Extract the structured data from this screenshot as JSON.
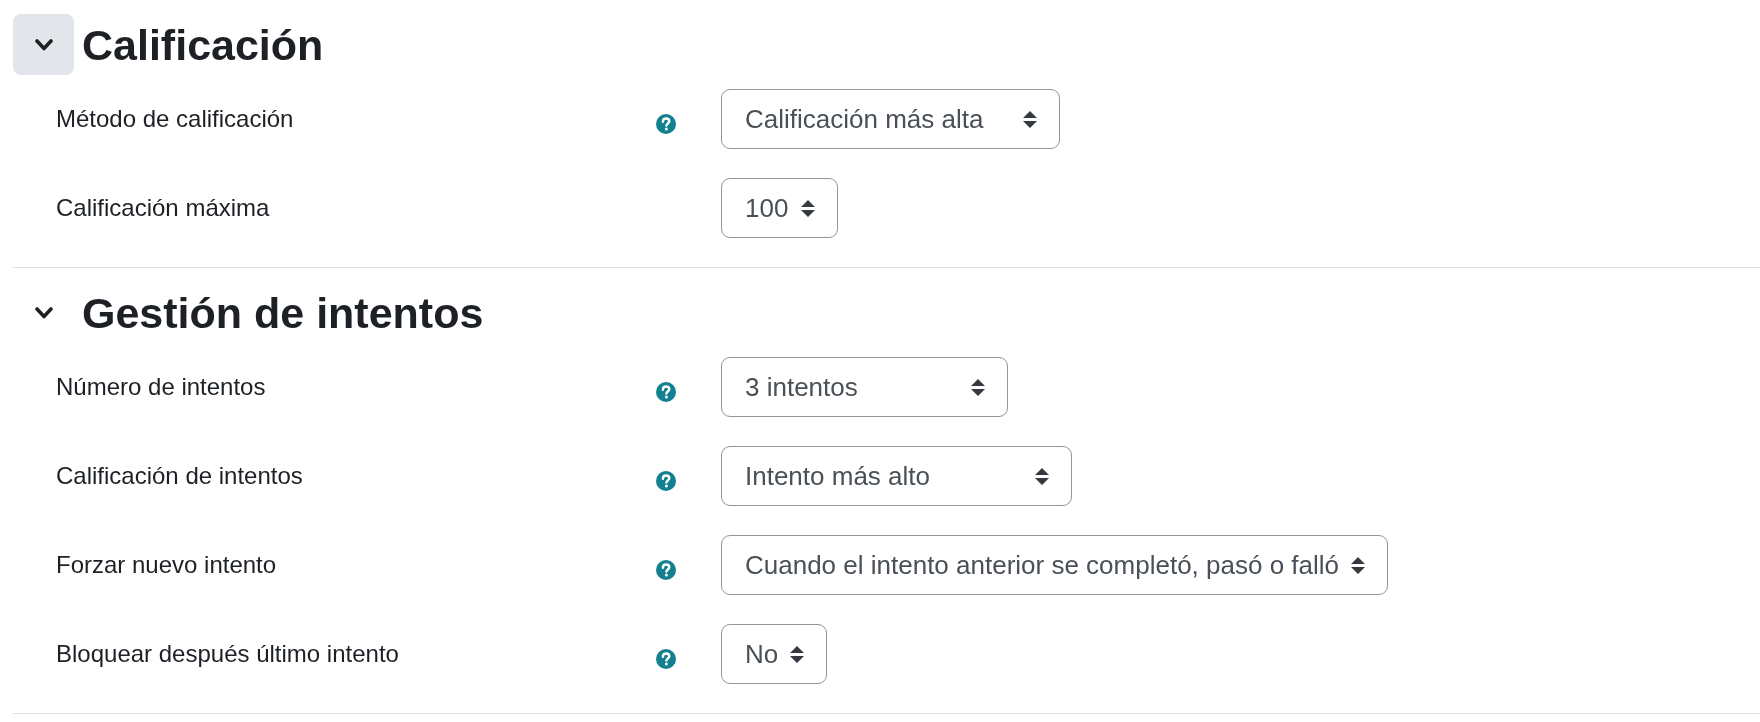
{
  "sections": [
    {
      "title": "Calificación",
      "expanded": true,
      "focused": true,
      "fields": [
        {
          "label": "Método de calificación",
          "help": true,
          "value": "Calificación más alta"
        },
        {
          "label": "Calificación máxima",
          "help": false,
          "value": "100"
        }
      ]
    },
    {
      "title": "Gestión de intentos",
      "expanded": true,
      "focused": false,
      "fields": [
        {
          "label": "Número de intentos",
          "help": true,
          "value": "3 intentos"
        },
        {
          "label": "Calificación de intentos",
          "help": true,
          "value": "Intento más alto"
        },
        {
          "label": "Forzar nuevo intento",
          "help": true,
          "value": "Cuando el intento anterior se completó, pasó o falló"
        },
        {
          "label": "Bloquear después último intento",
          "help": true,
          "value": "No"
        }
      ]
    }
  ]
}
